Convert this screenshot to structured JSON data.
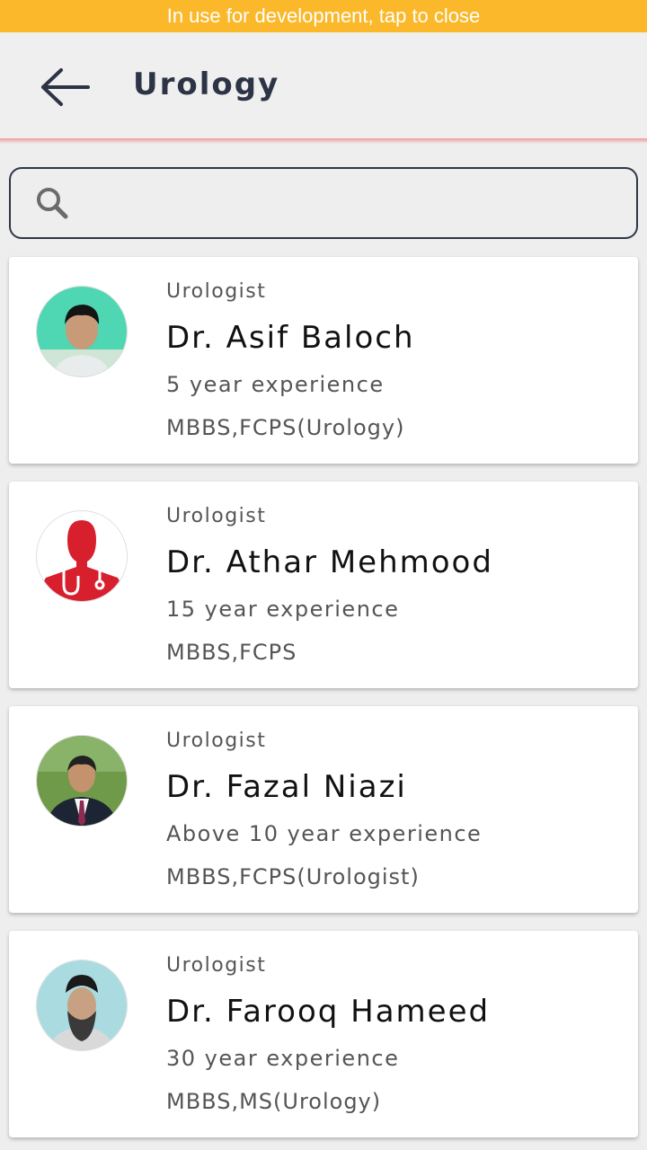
{
  "banner": {
    "text": "In use for development, tap to close",
    "color": "#fbb82a"
  },
  "header": {
    "back_icon": "arrow-left-icon",
    "title": "Urology"
  },
  "search": {
    "icon": "search-icon",
    "value": "",
    "placeholder": ""
  },
  "doctors": [
    {
      "specialty": "Urologist",
      "name": "Dr. Asif Baloch",
      "experience": "5 year experience",
      "qualification": "MBBS,FCPS(Urology)",
      "avatar": "doctor-photo"
    },
    {
      "specialty": "Urologist",
      "name": "Dr. Athar Mehmood",
      "experience": "15 year experience",
      "qualification": "MBBS,FCPS",
      "avatar": "doctor-placeholder-icon"
    },
    {
      "specialty": "Urologist",
      "name": "Dr. Fazal Niazi",
      "experience": "Above 10 year experience",
      "qualification": "MBBS,FCPS(Urologist)",
      "avatar": "doctor-photo"
    },
    {
      "specialty": "Urologist",
      "name": "Dr. Farooq Hameed",
      "experience": "30 year experience",
      "qualification": "MBBS,MS(Urology)",
      "avatar": "doctor-photo"
    }
  ],
  "colors": {
    "title": "#2c3445",
    "accent_divider": "#f09a9a",
    "placeholder_red": "#d71f2e"
  }
}
